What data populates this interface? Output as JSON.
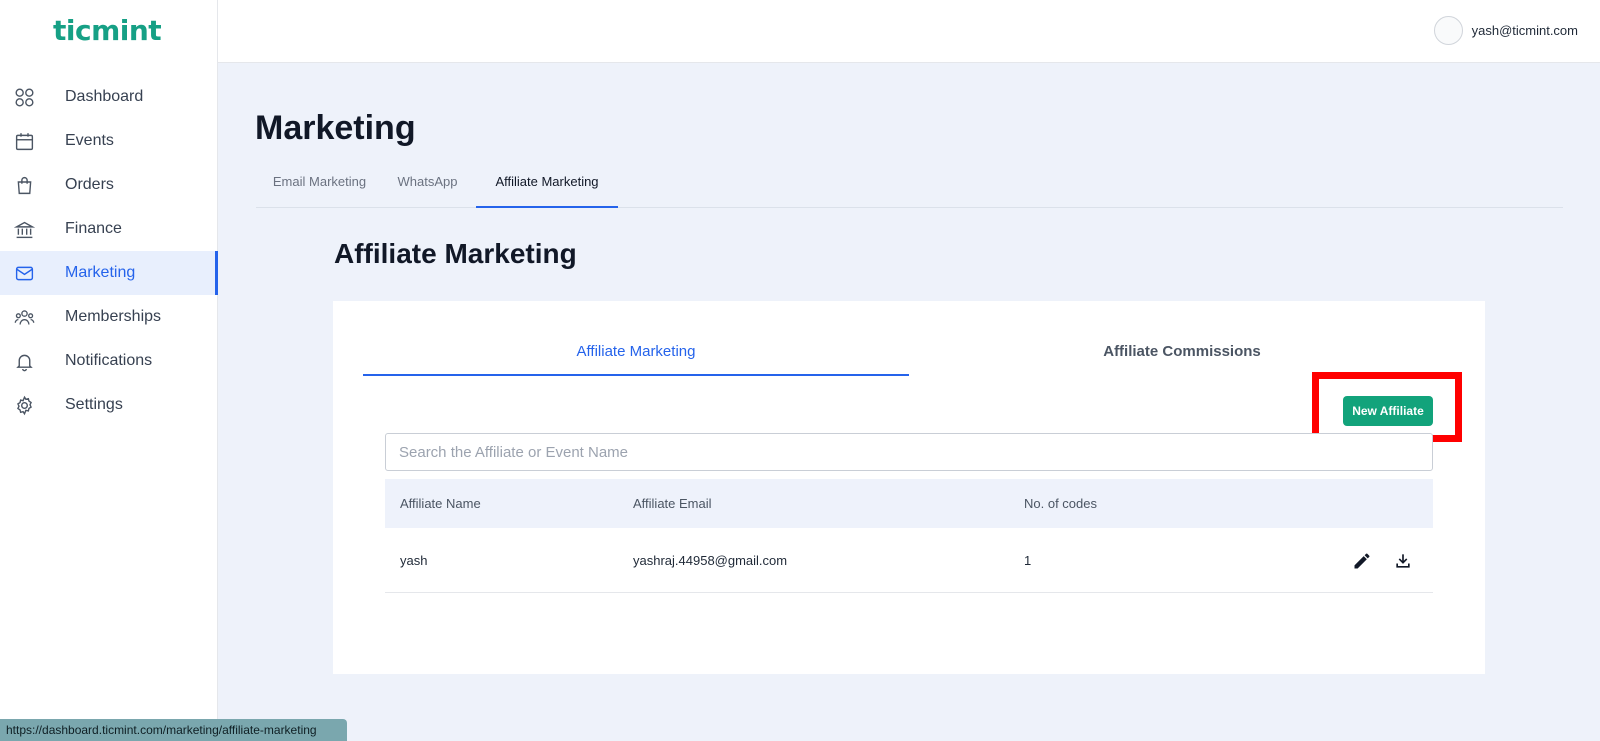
{
  "app": {
    "logo": "ticmint"
  },
  "sidebar": {
    "items": [
      {
        "label": "Dashboard",
        "icon": "grid-icon"
      },
      {
        "label": "Events",
        "icon": "calendar-icon"
      },
      {
        "label": "Orders",
        "icon": "shopping-bag-icon"
      },
      {
        "label": "Finance",
        "icon": "bank-icon"
      },
      {
        "label": "Marketing",
        "icon": "mail-icon",
        "active": true
      },
      {
        "label": "Memberships",
        "icon": "users-icon"
      },
      {
        "label": "Notifications",
        "icon": "bell-icon"
      },
      {
        "label": "Settings",
        "icon": "gear-icon"
      }
    ]
  },
  "header": {
    "user_email": "yash@ticmint.com"
  },
  "page": {
    "title": "Marketing",
    "tabs": [
      "Email Marketing",
      "WhatsApp",
      "Affiliate Marketing"
    ],
    "active_tab": "Affiliate Marketing"
  },
  "affiliate": {
    "section_title": "Affiliate Marketing",
    "sub_tabs": [
      "Affiliate Marketing",
      "Affiliate Commissions"
    ],
    "new_button": "New Affiliate",
    "search_placeholder": "Search the Affiliate or Event Name",
    "columns": [
      "Affiliate Name",
      "Affiliate Email",
      "No. of codes"
    ],
    "rows": [
      {
        "name": "yash",
        "email": "yashraj.44958@gmail.com",
        "codes": "1"
      }
    ]
  },
  "status_url": "https://dashboard.ticmint.com/marketing/affiliate-marketing",
  "colors": {
    "accent": "#2563eb",
    "brand": "#16a085",
    "button": "#12a37b",
    "highlight": "#ff0000"
  }
}
